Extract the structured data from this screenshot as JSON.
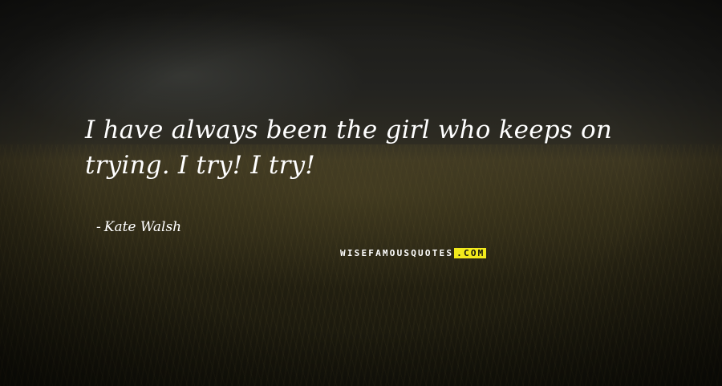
{
  "quote": {
    "line1": "I have always been the girl who keeps on",
    "line2": "trying. I try! I try!"
  },
  "author": {
    "dash": "-",
    "name": "Kate Walsh"
  },
  "watermark": {
    "main": "WISEFAMOUSQUOTES",
    "suffix": ".COM",
    "accent_color": "#f2ea1c"
  }
}
